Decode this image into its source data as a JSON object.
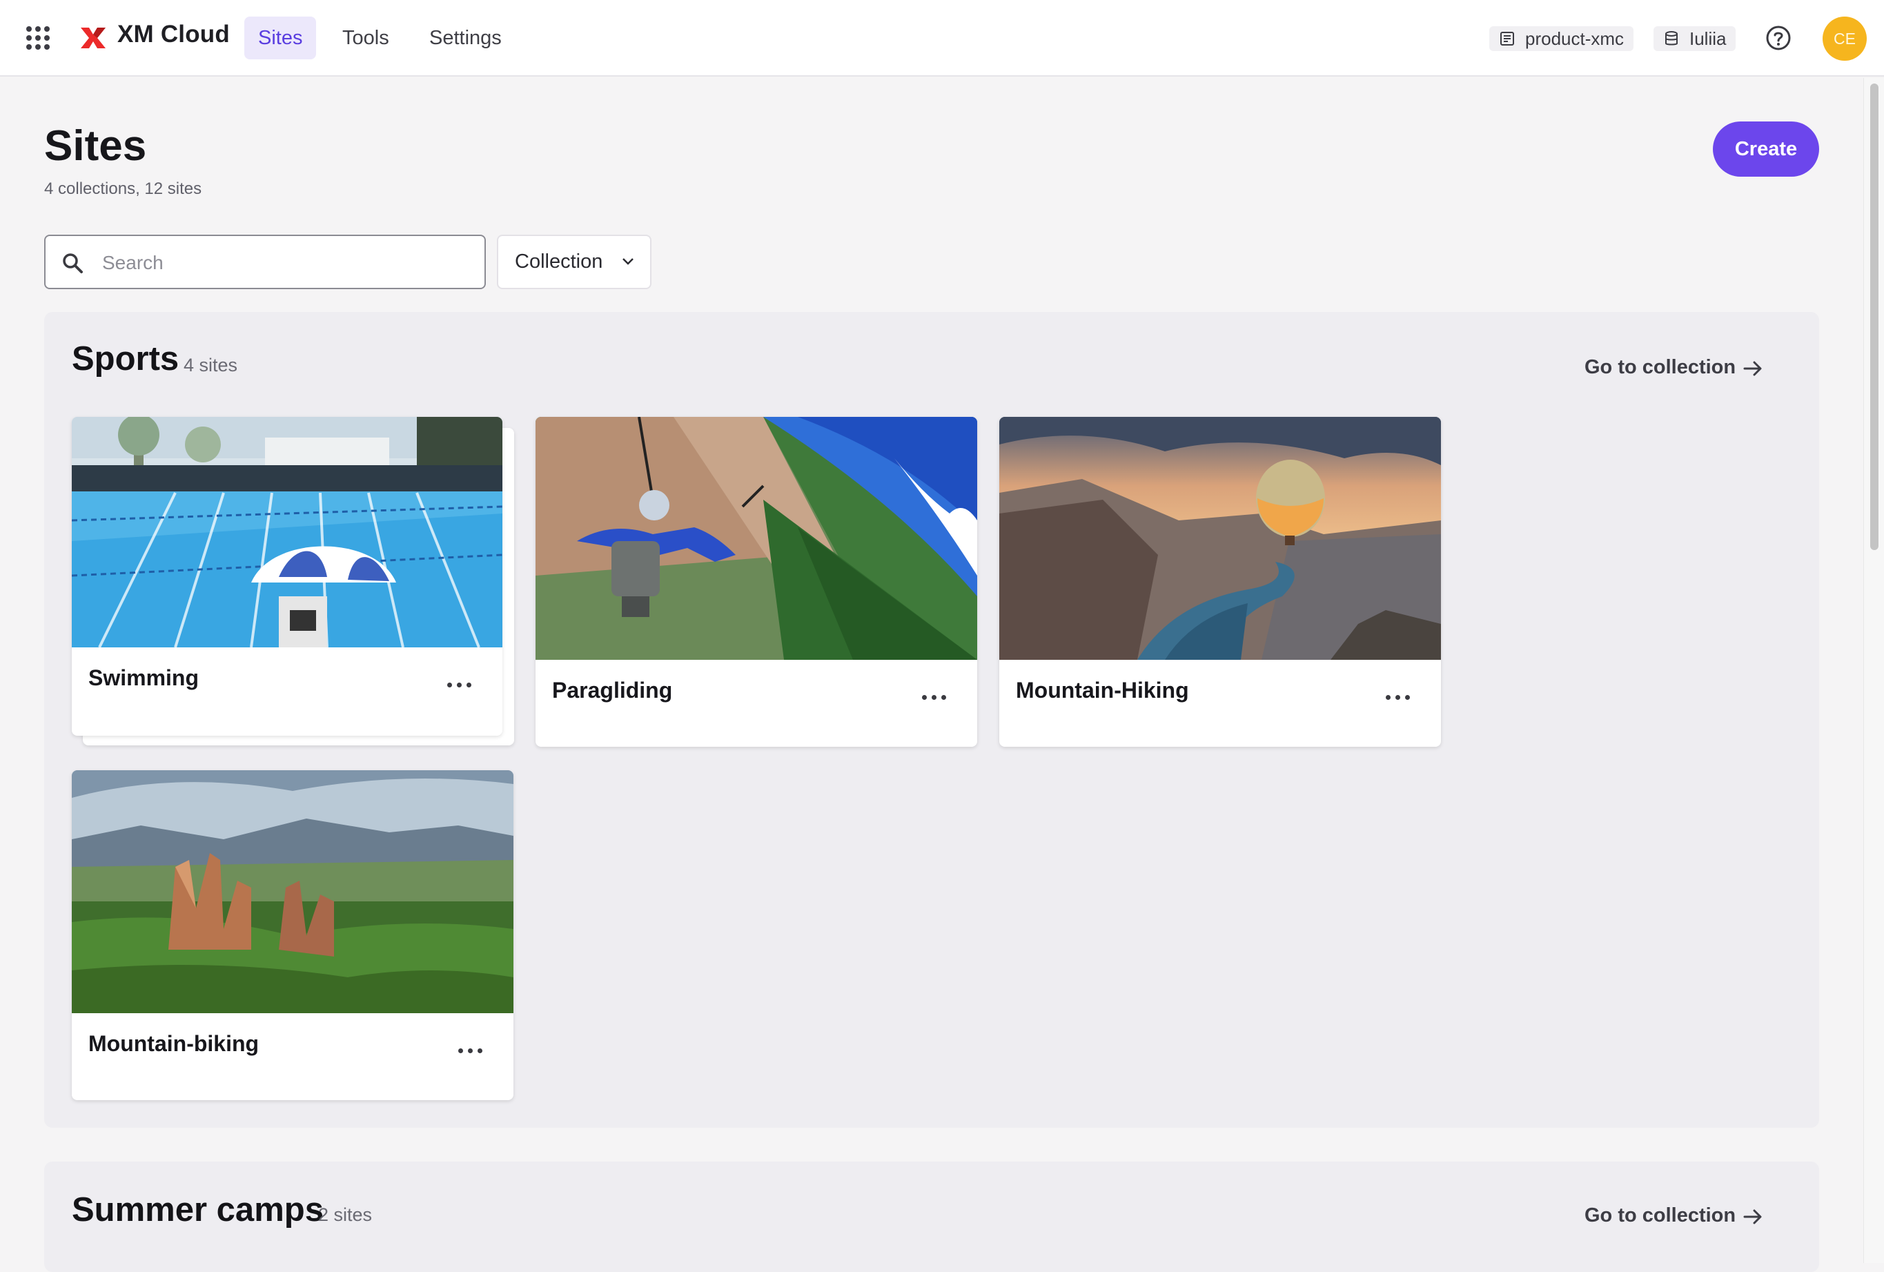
{
  "app": {
    "title": "XM Cloud"
  },
  "nav": {
    "tabs": [
      {
        "label": "Sites",
        "active": true
      },
      {
        "label": "Tools",
        "active": false
      },
      {
        "label": "Settings",
        "active": false
      }
    ]
  },
  "context": {
    "project": "product-xmc",
    "environment": "Iuliia"
  },
  "user": {
    "initials": "CE",
    "avatar_color": "#f6b51e"
  },
  "page": {
    "title": "Sites",
    "subtitle": "4 collections, 12 sites",
    "create_label": "Create",
    "accent": "#6c46ec"
  },
  "search": {
    "placeholder": "Search",
    "value": ""
  },
  "filter": {
    "label": "Collection"
  },
  "collections": [
    {
      "name": "Sports",
      "count": "4 sites",
      "link_label": "Go to collection",
      "sites": [
        {
          "name": "Swimming"
        },
        {
          "name": "Paragliding"
        },
        {
          "name": "Mountain-Hiking"
        },
        {
          "name": "Mountain-biking"
        }
      ]
    },
    {
      "name": "Summer camps",
      "count": "2 sites",
      "link_label": "Go to collection"
    }
  ]
}
